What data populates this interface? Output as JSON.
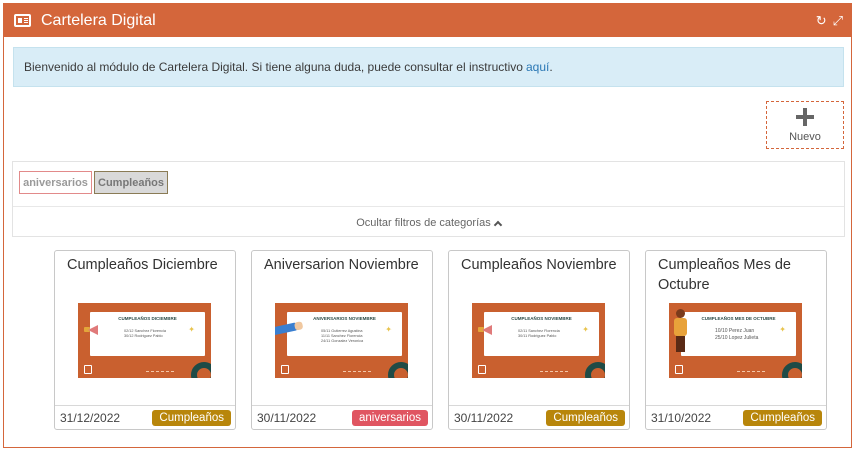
{
  "window": {
    "title": "Cartelera Digital",
    "icons": [
      "newspaper-icon",
      "refresh-icon",
      "expand-icon"
    ]
  },
  "alert": {
    "text": "Bienvenido al módulo de Cartelera Digital. Si tiene alguna duda, puede consultar el instructivo",
    "link_label": "aquí",
    "trailing": "."
  },
  "actions": {
    "new_label": "Nuevo"
  },
  "filters": {
    "chips": [
      "aniversarios",
      "Cumpleaños"
    ],
    "toggle_label": "Ocultar filtros de categorías"
  },
  "colors": {
    "brand": "#d4663b",
    "alert_bg": "#d9edf7",
    "badge_cumpleanos": "#b8860b",
    "badge_aniversarios": "#e05561"
  },
  "cards": [
    {
      "title": "Cumpleaños Diciembre",
      "date": "31/12/2022",
      "category": "Cumpleaños",
      "thumb": {
        "heading": "CUMPLEAÑOS DICIEMBRE",
        "lines": [
          "02/12 Sanchez Florencia",
          "30/12 Rodriguez Pablo"
        ]
      }
    },
    {
      "title": "Aniversarion Noviembre",
      "date": "30/11/2022",
      "category": "aniversarios",
      "thumb": {
        "heading": "ANIVERSARIOS NOVIEMBRE",
        "lines": [
          "05/11 Gutierrez Agustina",
          "11/11 Sanchez Florencia",
          "24/11 Gonzalez Veronica"
        ]
      }
    },
    {
      "title": "Cumpleaños Noviembre",
      "date": "30/11/2022",
      "category": "Cumpleaños",
      "thumb": {
        "heading": "CUMPLEAÑOS NOVIEMBRE",
        "lines": [
          "02/11 Sanchez Florencia",
          "30/11 Rodriguez Pablo"
        ]
      }
    },
    {
      "title": "Cumpleaños Mes de Octubre",
      "date": "31/10/2022",
      "category": "Cumpleaños",
      "thumb": {
        "heading": "CUMPLEAÑOS MES DE OCTUBRE",
        "lines": [
          "10/10 Perez Juan",
          "25/10 Lopez Julieta"
        ]
      }
    }
  ]
}
